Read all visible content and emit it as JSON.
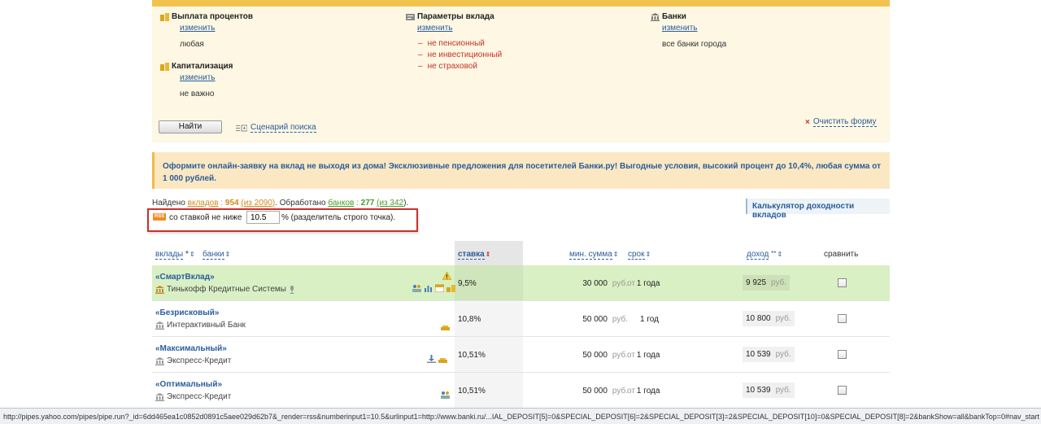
{
  "filters": {
    "interest_payment": {
      "title": "Выплата процентов",
      "change": "изменить",
      "value": "любая"
    },
    "capitalization": {
      "title": "Капитализация",
      "change": "изменить",
      "value": "не важно"
    },
    "deposit_params": {
      "title": "Параметры вклада",
      "change": "изменить",
      "items": [
        "не пенсионный",
        "не инвестиционный",
        "не страховой"
      ]
    },
    "banks": {
      "title": "Банки",
      "change": "изменить",
      "value": "все банки города"
    },
    "find_button": "Найти",
    "scenario_link": "Сценарий поиска",
    "clear_link": "Очистить форму"
  },
  "promo": {
    "text": "Оформите онлайн-заявку на вклад не выходя из дома! Эксклюзивные предложения для посетителей Банки.ру! Выгодные условия, высокий процент до 10,4%, любая сумма от 1 000 рублей."
  },
  "results": {
    "found_prefix": "Найдено",
    "deposits_word": "вкладов",
    "deposits_count": "954",
    "deposits_total": "(из 2090)",
    "processed": ". Обработано",
    "banks_word": "банков",
    "banks_count": "277",
    "banks_total": "(из 342",
    "tail": ").",
    "calculator": "Калькулятор доходности вкладов"
  },
  "rss": {
    "badge": "RSS",
    "label": "со ставкой не ниже",
    "value": "10.5",
    "note": "% (разделитель строго точка)."
  },
  "table": {
    "headers": {
      "deposits": "вклады",
      "deposits_mark": "*",
      "banks": "банки",
      "rate": "ставка",
      "min_sum": "мин. сумма",
      "term": "срок",
      "income": "доход",
      "income_mark": "**",
      "compare": "сравнить"
    },
    "rows": [
      {
        "name": "«СмартВклад»",
        "bank": "Тинькофф Кредитные Системы",
        "rate": "9,5%",
        "min_sum": "30 000",
        "currency": "руб.",
        "term_prefix": "от",
        "term": "1 года",
        "income": "9 925",
        "income_cur": "руб."
      },
      {
        "name": "«Безрисковый»",
        "bank": "Интерактивный Банк",
        "rate": "10,8%",
        "min_sum": "50 000",
        "currency": "руб.",
        "term_prefix": "",
        "term": "1 год",
        "income": "10 800",
        "income_cur": "руб."
      },
      {
        "name": "«Максимальный»",
        "bank": "Экспресс-Кредит",
        "rate": "10,51%",
        "min_sum": "50 000",
        "currency": "руб.",
        "term_prefix": "от",
        "term": "1 года",
        "income": "10 539",
        "income_cur": "руб."
      },
      {
        "name": "«Оптимальный»",
        "bank": "Экспресс-Кредит",
        "rate": "10,51%",
        "min_sum": "50 000",
        "currency": "руб.",
        "term_prefix": "от",
        "term": "1 года",
        "income": "10 539",
        "income_cur": "руб."
      }
    ]
  },
  "statusbar": {
    "url": "http://pipes.yahoo.com/pipes/pipe.run?_id=6dd465ea1c0852d0891c5aee029d62b7&_render=rss&numberinput1=10.5&urlinput1=http://www.banki.ru/...IAL_DEPOSIT[5]=0&SPECIAL_DEPOSIT[6]=2&SPECIAL_DEPOSIT[3]=2&SPECIAL_DEPOSIT[10]=0&SPECIAL_DEPOSIT[8]=2&bankShow=all&bankTop=0#nav_start"
  },
  "colors": {
    "accent_bar": "#f2c24f",
    "link": "#2a5c9a",
    "negative": "#c8322a",
    "highlight_row": "#d9f0c4"
  }
}
